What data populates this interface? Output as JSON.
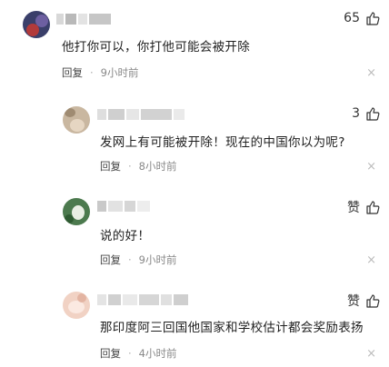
{
  "comments": [
    {
      "likes": "65",
      "text": "他打你可以，你打他可能会被开除",
      "reply_label": "回复",
      "separator": "·",
      "time": "9小时前",
      "close_glyph": "×"
    },
    {
      "likes": "3",
      "text": "发网上有可能被开除！现在的中国你以为呢?",
      "reply_label": "回复",
      "separator": "·",
      "time": "8小时前",
      "close_glyph": "×"
    },
    {
      "likes": "赞",
      "text": "说的好！",
      "reply_label": "回复",
      "separator": "·",
      "time": "9小时前",
      "close_glyph": "×"
    },
    {
      "likes": "赞",
      "text": "那印度阿三回国他国家和学校估计都会奖励表扬",
      "reply_label": "回复",
      "separator": "·",
      "time": "4小时前",
      "close_glyph": "×"
    }
  ],
  "icons": {
    "like": "thumbs-up-icon",
    "close": "close-icon"
  }
}
